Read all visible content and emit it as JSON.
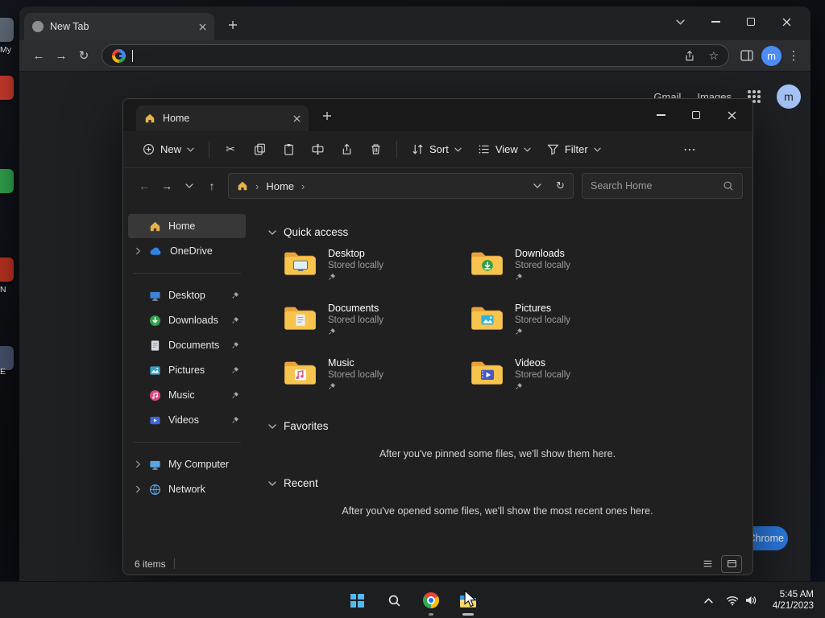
{
  "desktop": {
    "icons": [
      {
        "label": "My",
        "color": "#5d6875"
      },
      {
        "label": "",
        "color": "#c6392c"
      },
      {
        "label": "",
        "color": "#2e9e49"
      },
      {
        "label": "N",
        "color": "#b5301f"
      },
      {
        "label": "E",
        "color": "#46506b"
      }
    ]
  },
  "chrome": {
    "tab_title": "New Tab",
    "omnibox_value": "",
    "links": {
      "gmail": "Gmail",
      "images": "Images"
    },
    "avatar_letter": "m",
    "customize_label": "Customize Chrome",
    "colors": {
      "accent_blue": "#2c7ce5",
      "toolbar": "#2b2d31",
      "frame": "#202124"
    }
  },
  "explorer": {
    "tab_title": "Home",
    "commandbar": {
      "new": "New",
      "sort": "Sort",
      "view": "View",
      "filter": "Filter"
    },
    "address": {
      "location": "Home",
      "search_placeholder": "Search Home"
    },
    "sidebar": [
      {
        "label": "Home"
      },
      {
        "label": "OneDrive"
      },
      {
        "label": "Desktop"
      },
      {
        "label": "Downloads"
      },
      {
        "label": "Documents"
      },
      {
        "label": "Pictures"
      },
      {
        "label": "Music"
      },
      {
        "label": "Videos"
      },
      {
        "label": "My Computer"
      },
      {
        "label": "Network"
      }
    ],
    "sections": {
      "quick_access": "Quick access",
      "favorites": "Favorites",
      "recent": "Recent"
    },
    "quick_items": [
      {
        "name": "Desktop",
        "status": "Stored locally"
      },
      {
        "name": "Downloads",
        "status": "Stored locally"
      },
      {
        "name": "Documents",
        "status": "Stored locally"
      },
      {
        "name": "Pictures",
        "status": "Stored locally"
      },
      {
        "name": "Music",
        "status": "Stored locally"
      },
      {
        "name": "Videos",
        "status": "Stored locally"
      }
    ],
    "favorites_empty": "After you've pinned some files, we'll show them here.",
    "recent_empty": "After you've opened some files, we'll show the most recent ones here.",
    "status": "6 items",
    "colors": {
      "window": "#202020",
      "folder": "#f7c44d"
    }
  },
  "taskbar": {
    "time": "5:45 AM",
    "date": "4/21/2023"
  },
  "icons": {
    "back": "←",
    "forward": "→",
    "up": "↑",
    "reload": "↻",
    "cut": "✂",
    "more": "⋯",
    "kebab": "⋮",
    "star": "☆",
    "sep": "›"
  }
}
